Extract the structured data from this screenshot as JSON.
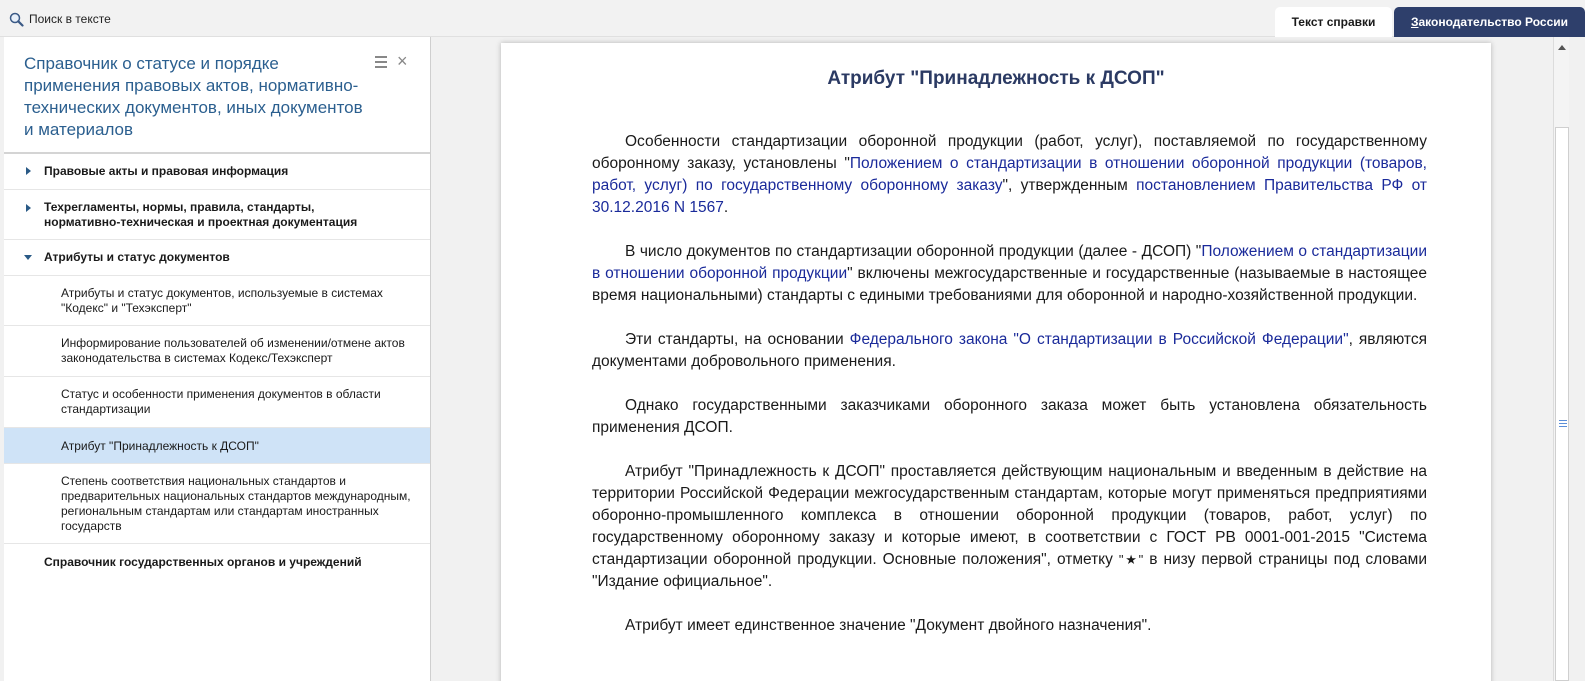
{
  "toolbar": {
    "search_label": "Поиск в тексте",
    "search_icon": "magnifier-icon"
  },
  "tabs": [
    {
      "label": "Текст справки",
      "active": true
    },
    {
      "label_first": "З",
      "label_rest": "аконодательство России",
      "active": false
    }
  ],
  "sidebar": {
    "title": "Справочник о статусе и порядке применения правовых актов, нормативно-технических документов, иных документов и материалов",
    "menu_icon": "hamburger-icon",
    "close_icon": "close-icon",
    "items": [
      {
        "label": "Правовые акты и правовая информация",
        "expanded": false
      },
      {
        "label": "Техрегламенты, нормы, правила, стандарты, нормативно-техническая и проектная документация",
        "expanded": false
      },
      {
        "label": "Атрибуты и статус документов",
        "expanded": true
      },
      {
        "label": "Атрибуты и статус документов, используемые в системах \"Кодекс\" и \"Техэксперт\""
      },
      {
        "label": "Информирование пользователей об изменении/отмене актов законодательства в системах Кодекс/Техэксперт"
      },
      {
        "label": "Статус и особенности применения документов в области стандартизации"
      },
      {
        "label": "Атрибут \"Принадлежность к ДСОП\"",
        "selected": true
      },
      {
        "label": "Степень соответствия национальных стандартов и предварительных национальных стандартов международным, региональным стандартам или стандартам иностранных государств"
      },
      {
        "label": "Справочник государственных органов и учреждений"
      }
    ]
  },
  "document": {
    "title": "Атрибут \"Принадлежность к ДСОП\"",
    "p1": {
      "t1": "Особенности стандартизации оборонной продукции (работ, услуг), поставляемой по государственному оборонному заказу, установлены \"",
      "l1": "Положением о стандартизации в отношении оборонной продукции (товаров, работ, услуг) по государственному оборонному заказу",
      "t2": "\", утвержденным ",
      "l2": "постановлением Правительства РФ от 30.12.2016 N 1567",
      "t3": "."
    },
    "p2": {
      "t1": "В число документов по стандартизации оборонной продукции (далее - ДСОП) \"",
      "l1": "Положением о стандартизации в отношении оборонной продукции",
      "t2": "\" включены межгосударственные и государственные (называемые в настоящее время национальными) стандарты с едиными требованиями для оборонной и народно-хозяйственной продукции."
    },
    "p3": {
      "t1": "Эти стандарты, на основании ",
      "l1": "Федерального закона \"О стандартизации в Российской Федерации\"",
      "t2": ", являются документами добровольного применения."
    },
    "p4": {
      "t1": "Однако государственными заказчиками оборонного заказа может быть установлена обязательность применения ДСОП."
    },
    "p5": {
      "t1": "Атрибут \"Принадлежность к ДСОП\" проставляется действующим национальным и введенным в действие на территории Российской Федерации межгосударственным стандартам, которые могут применяться предприятиями оборонно-промышленного комплекса в отношении оборонной продукции (товаров, работ, услуг) по государственному оборонному заказу и которые имеют, в соответствии с ГОСТ РВ 0001-001-2015 \"Система стандартизации оборонной продукции. Основные положения\", отметку ",
      "mark": "\"★\"",
      "t2": " в низу первой страницы под словами \"Издание официальное\"."
    },
    "p6": {
      "t1": "Атрибут имеет единственное значение \"Документ двойного назначения\"."
    }
  },
  "colors": {
    "accent": "#2e3f6b",
    "link": "#1a2a9a",
    "sidebar_title": "#2b5f8f",
    "selected_bg": "#cfe3f7"
  }
}
